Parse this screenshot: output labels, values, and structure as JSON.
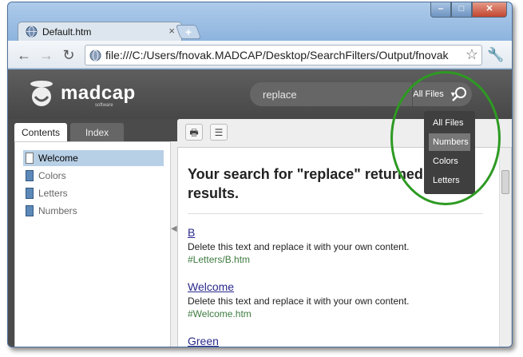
{
  "browser": {
    "tab_title": "Default.htm",
    "tab_close": "×",
    "new_tab": "+",
    "url": "file:///C:/Users/fnovak.MADCAP/Desktop/SearchFilters/Output/fnovak",
    "window_buttons": {
      "minimize": "‒",
      "maximize": "□",
      "close": "✕"
    },
    "nav": {
      "back": "←",
      "forward": "→",
      "reload": "↻"
    },
    "bookmark_star": "☆",
    "wrench": "🔧"
  },
  "header": {
    "logo_text": "madcap",
    "logo_sub": "software",
    "search_value": "replace",
    "filter_label": "All Files",
    "filter_caret": "▼"
  },
  "filter_dropdown": {
    "options": [
      "All Files",
      "Numbers",
      "Colors",
      "Letters"
    ],
    "highlighted": "Numbers"
  },
  "panel_tabs": {
    "contents": "Contents",
    "index": "Index"
  },
  "toc": [
    {
      "label": "Welcome",
      "icon": "document-icon",
      "active": true
    },
    {
      "label": "Colors",
      "icon": "book-icon"
    },
    {
      "label": "Letters",
      "icon": "book-icon"
    },
    {
      "label": "Numbers",
      "icon": "book-icon"
    }
  ],
  "content_toolbar": {
    "print": "🖶",
    "toggle": "☰"
  },
  "results": {
    "heading": "Your search for \"replace\" returned 9 results.",
    "items": [
      {
        "title": "B",
        "description": "Delete this text and replace it with your own content.",
        "link": "#Letters/B.htm"
      },
      {
        "title": "Welcome",
        "description": "Delete this text and replace it with your own content.",
        "link": "#Welcome.htm"
      },
      {
        "title": "Green",
        "description": "",
        "link": ""
      }
    ]
  },
  "colors": {
    "header_bg": "#4b4b4b",
    "highlight_ring": "#2d9a22",
    "link_green": "#3d7b3f",
    "link_blue": "#2a2a8c"
  }
}
